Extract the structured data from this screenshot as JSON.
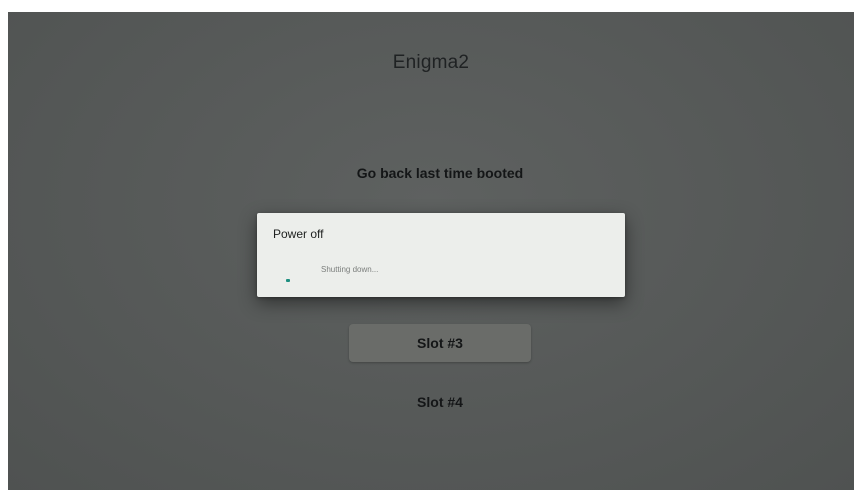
{
  "app": {
    "title": "Enigma2"
  },
  "menu": {
    "items": [
      {
        "label": "Go back last time booted"
      },
      {
        "label": "Slot #3",
        "selected": true
      },
      {
        "label": "Slot #4"
      }
    ]
  },
  "dialog": {
    "title": "Power off",
    "message": "Shutting down...",
    "progress_icon": "spinner-icon",
    "accent_color": "#1e8f80"
  }
}
